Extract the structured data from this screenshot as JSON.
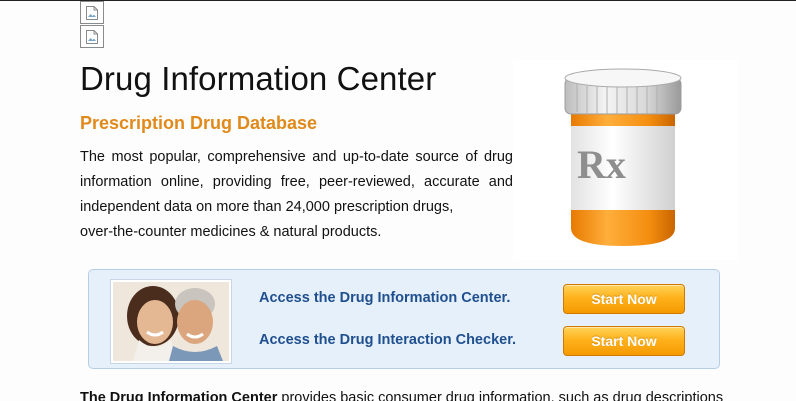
{
  "header": {
    "title": "Drug Information Center",
    "subtitle": "Prescription Drug Database",
    "description_lines": [
      "The most popular, comprehensive and up-to-date source of drug",
      "information online, providing free, peer-reviewed, accurate and",
      "independent data on more than 24,000 prescription drugs,",
      "over-the-counter medicines & natural products."
    ],
    "bottle_label": "Rx"
  },
  "promo": {
    "links": [
      {
        "label": "Access the Drug Information Center.",
        "button": "Start Now"
      },
      {
        "label": "Access the Drug Interaction Checker.",
        "button": "Start Now"
      }
    ]
  },
  "footer": {
    "bold_lead": "The Drug Information Center",
    "rest": " provides basic consumer drug information, such as drug descriptions"
  },
  "colors": {
    "subtitle": "#e08a1c",
    "link": "#1f4f8f",
    "button": "#ffb21c",
    "promo_bg": "#e6f0fa"
  }
}
